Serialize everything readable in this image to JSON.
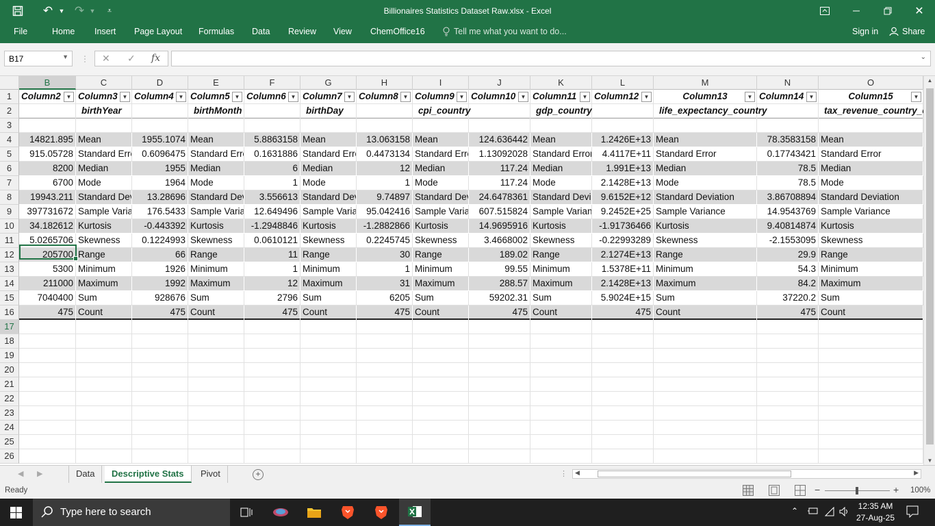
{
  "window": {
    "title": "Billionaires Statistics Dataset Raw.xlsx  -  Excel",
    "undo_glyph": "↶",
    "redo_glyph": "↷"
  },
  "menu": [
    "File",
    "Home",
    "Insert",
    "Page Layout",
    "Formulas",
    "Data",
    "Review",
    "View",
    "ChemOffice16",
    "Tell me what you want to do...",
    "Sign in",
    "Share"
  ],
  "formula_bar": {
    "name_box": "B17",
    "cancel": "✕",
    "enter": "✓",
    "fx": "fx",
    "value": ""
  },
  "column_headers": [
    "B",
    "C",
    "D",
    "E",
    "F",
    "G",
    "H",
    "I",
    "J",
    "K",
    "L",
    "M",
    "N",
    "O"
  ],
  "row_numbers": [
    "1",
    "2",
    "3",
    "4",
    "5",
    "6",
    "7",
    "8",
    "9",
    "10",
    "11",
    "12",
    "13",
    "14",
    "15",
    "16",
    "17",
    "18",
    "19",
    "20",
    "21",
    "22",
    "23",
    "24",
    "25",
    "26"
  ],
  "table_headers": [
    "Column2",
    "Column3",
    "Column4",
    "Column5",
    "Column6",
    "Column7",
    "Column8",
    "Column9",
    "Column10",
    "Column11",
    "Column12",
    "Column13",
    "Column14",
    "Column15"
  ],
  "group_labels": [
    {
      "col": "C",
      "text": "birthYear"
    },
    {
      "col": "E",
      "text": "birthMonth"
    },
    {
      "col": "G",
      "text": "birthDay"
    },
    {
      "col": "I",
      "text": "cpi_country"
    },
    {
      "col": "K",
      "text": "gdp_country"
    },
    {
      "col": "M",
      "text": "life_expectancy_country"
    },
    {
      "col": "O",
      "text": "tax_revenue_country_country"
    }
  ],
  "stats_rows": [
    [
      "14821.895",
      "Mean",
      "1955.1074",
      "Mean",
      "5.8863158",
      "Mean",
      "13.063158",
      "Mean",
      "124.636442",
      "Mean",
      "1.2426E+13",
      "Mean",
      "78.3583158",
      "Mean"
    ],
    [
      "915.05728",
      "Standard Error",
      "0.6096475",
      "Standard Error",
      "0.1631886",
      "Standard Error",
      "0.4473134",
      "Standard Error",
      "1.13092028",
      "Standard Error",
      "4.4117E+11",
      "Standard Error",
      "0.17743421",
      "Standard Error"
    ],
    [
      "8200",
      "Median",
      "1955",
      "Median",
      "6",
      "Median",
      "12",
      "Median",
      "117.24",
      "Median",
      "1.991E+13",
      "Median",
      "78.5",
      "Median"
    ],
    [
      "6700",
      "Mode",
      "1964",
      "Mode",
      "1",
      "Mode",
      "1",
      "Mode",
      "117.24",
      "Mode",
      "2.1428E+13",
      "Mode",
      "78.5",
      "Mode"
    ],
    [
      "19943.211",
      "Standard Deviation",
      "13.28696",
      "Standard Deviation",
      "3.556613",
      "Standard Deviation",
      "9.74897",
      "Standard Deviation",
      "24.6478361",
      "Standard Deviation",
      "9.6152E+12",
      "Standard Deviation",
      "3.86708894",
      "Standard Deviation"
    ],
    [
      "397731672",
      "Sample Variance",
      "176.5433",
      "Sample Variance",
      "12.649496",
      "Sample Variance",
      "95.042416",
      "Sample Variance",
      "607.515824",
      "Sample Variance",
      "9.2452E+25",
      "Sample Variance",
      "14.9543769",
      "Sample Variance"
    ],
    [
      "34.182612",
      "Kurtosis",
      "-0.443392",
      "Kurtosis",
      "-1.2948846",
      "Kurtosis",
      "-1.2882866",
      "Kurtosis",
      "14.9695916",
      "Kurtosis",
      "-1.91736466",
      "Kurtosis",
      "9.40814874",
      "Kurtosis"
    ],
    [
      "5.0265706",
      "Skewness",
      "0.1224993",
      "Skewness",
      "0.0610121",
      "Skewness",
      "0.2245745",
      "Skewness",
      "3.4668002",
      "Skewness",
      "-0.22993289",
      "Skewness",
      "-2.1553095",
      "Skewness"
    ],
    [
      "205700",
      "Range",
      "66",
      "Range",
      "11",
      "Range",
      "30",
      "Range",
      "189.02",
      "Range",
      "2.1274E+13",
      "Range",
      "29.9",
      "Range"
    ],
    [
      "5300",
      "Minimum",
      "1926",
      "Minimum",
      "1",
      "Minimum",
      "1",
      "Minimum",
      "99.55",
      "Minimum",
      "1.5378E+11",
      "Minimum",
      "54.3",
      "Minimum"
    ],
    [
      "211000",
      "Maximum",
      "1992",
      "Maximum",
      "12",
      "Maximum",
      "31",
      "Maximum",
      "288.57",
      "Maximum",
      "2.1428E+13",
      "Maximum",
      "84.2",
      "Maximum"
    ],
    [
      "7040400",
      "Sum",
      "928676",
      "Sum",
      "2796",
      "Sum",
      "6205",
      "Sum",
      "59202.31",
      "Sum",
      "5.9024E+15",
      "Sum",
      "37220.2",
      "Sum"
    ],
    [
      "475",
      "Count",
      "475",
      "Count",
      "475",
      "Count",
      "475",
      "Count",
      "475",
      "Count",
      "475",
      "Count",
      "475",
      "Count"
    ]
  ],
  "sheets": [
    "Data",
    "Descriptive Stats",
    "Pivot"
  ],
  "active_sheet": "Descriptive Stats",
  "status": {
    "ready": "Ready",
    "zoom": "100%",
    "zoom_percent": 100
  },
  "taskbar": {
    "search_placeholder": "Type here to search",
    "time": "12:35 AM",
    "date": "27-Aug-25"
  },
  "colors": {
    "excel_green": "#217346",
    "band_gray": "#d9d9d9",
    "taskbar": "#1f1f1f"
  }
}
